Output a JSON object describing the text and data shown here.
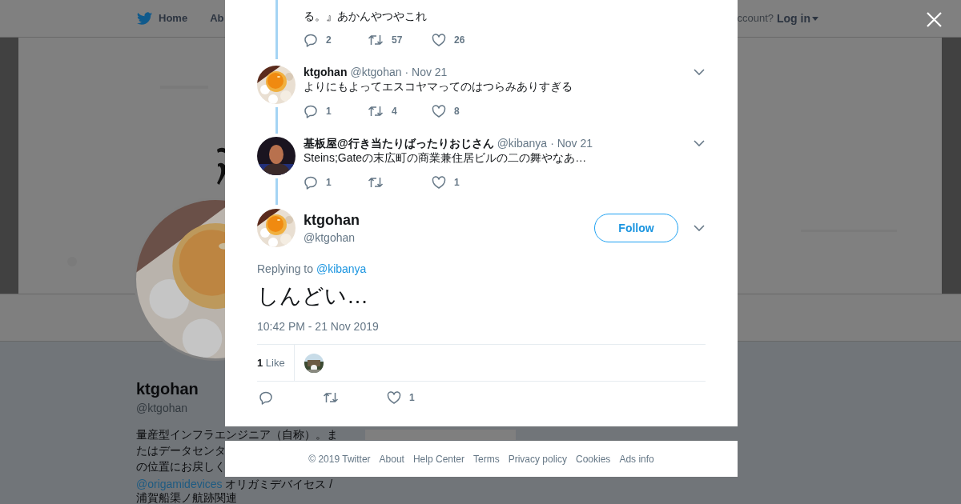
{
  "nav": {
    "home": "Home",
    "about": "Ab",
    "account_prompt": "ccount?",
    "login": "Log in"
  },
  "profile": {
    "name": "ktgohan",
    "handle": "@ktgohan",
    "bio": [
      {
        "text": "量産型インフラエンジニア（自称）。ま"
      },
      {
        "text": "たはデータセンタ"
      },
      {
        "text": "の位置にお戻しく"
      },
      {
        "link": "@origamidevices",
        "text": " オリガミデバイセス /"
      },
      {
        "text": "浦賀船渠ノ航跡関連"
      }
    ]
  },
  "thread": [
    {
      "text_lines": [
        "る。』あかんやつやこれ"
      ],
      "replies": "2",
      "retweets": "57",
      "likes": "26"
    },
    {
      "name": "ktgohan",
      "handle": "@ktgohan",
      "date": "· Nov 21",
      "text": "よりにもよってエスコヤマってのはつらみありすぎる",
      "replies": "1",
      "retweets": "4",
      "likes": "8"
    },
    {
      "name": "基板屋@行き当たりばったりおじさん",
      "handle": "@kibanya",
      "date": "· Nov 21",
      "text": "Steins;Gateの末広町の商業兼住居ビルの二の舞やなあ…",
      "replies": "1",
      "likes": "1"
    }
  ],
  "tweet": {
    "name": "ktgohan",
    "handle": "@ktgohan",
    "follow": "Follow",
    "replying_label": "Replying to",
    "replying_to": "@kibanya",
    "text": "しんどい…",
    "timestamp": "10:42 PM - 21 Nov 2019",
    "likes_summary": "**1** Like",
    "likes": "1"
  },
  "footer": {
    "links": [
      "© 2019 Twitter",
      "About",
      "Help Center",
      "Terms",
      "Privacy policy",
      "Cookies",
      "Ads info"
    ]
  }
}
